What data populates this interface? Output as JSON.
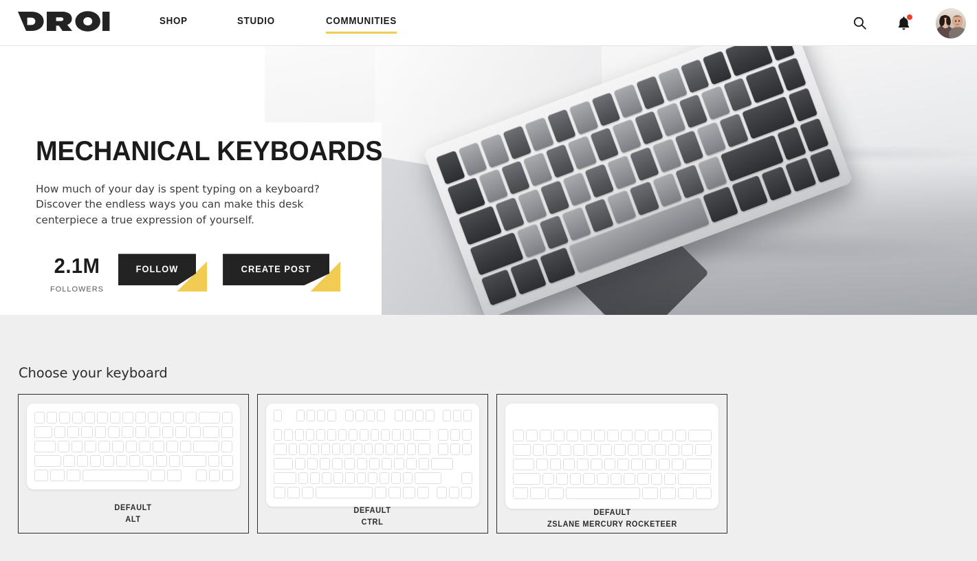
{
  "header": {
    "logo_text": "DROP",
    "logo_icon": "drop-logo",
    "nav": [
      {
        "label": "SHOP",
        "active": false
      },
      {
        "label": "STUDIO",
        "active": false
      },
      {
        "label": "COMMUNITIES",
        "active": true
      }
    ],
    "search_icon": "search-icon",
    "notifications_icon": "bell-icon",
    "has_notification": true,
    "avatar_icon": "user-avatar",
    "accent_color": "#f2cc52"
  },
  "hero": {
    "title": "MECHANICAL KEYBOARDS",
    "description": "How much of your day is spent typing on a keyboard? Discover the endless ways you can make this desk centerpiece a true expression of yourself.",
    "followers_count": "2.1M",
    "followers_label": "FOLLOWERS",
    "follow_button": "FOLLOW",
    "create_post_button": "CREATE POST",
    "image_alt": "mechanical-keyboard-photo"
  },
  "chooser": {
    "title": "Choose your keyboard",
    "cards": [
      {
        "default_label": "DEFAULT",
        "name": "ALT",
        "layout": "65"
      },
      {
        "default_label": "DEFAULT",
        "name": "CTRL",
        "layout": "tkl"
      },
      {
        "default_label": "DEFAULT",
        "name": "ZSLANE MERCURY ROCKETEER",
        "layout": "60"
      }
    ]
  },
  "colors": {
    "accent": "#f2cc52",
    "dark": "#232323",
    "page_bg": "#efefef",
    "notification": "#e8432a"
  }
}
